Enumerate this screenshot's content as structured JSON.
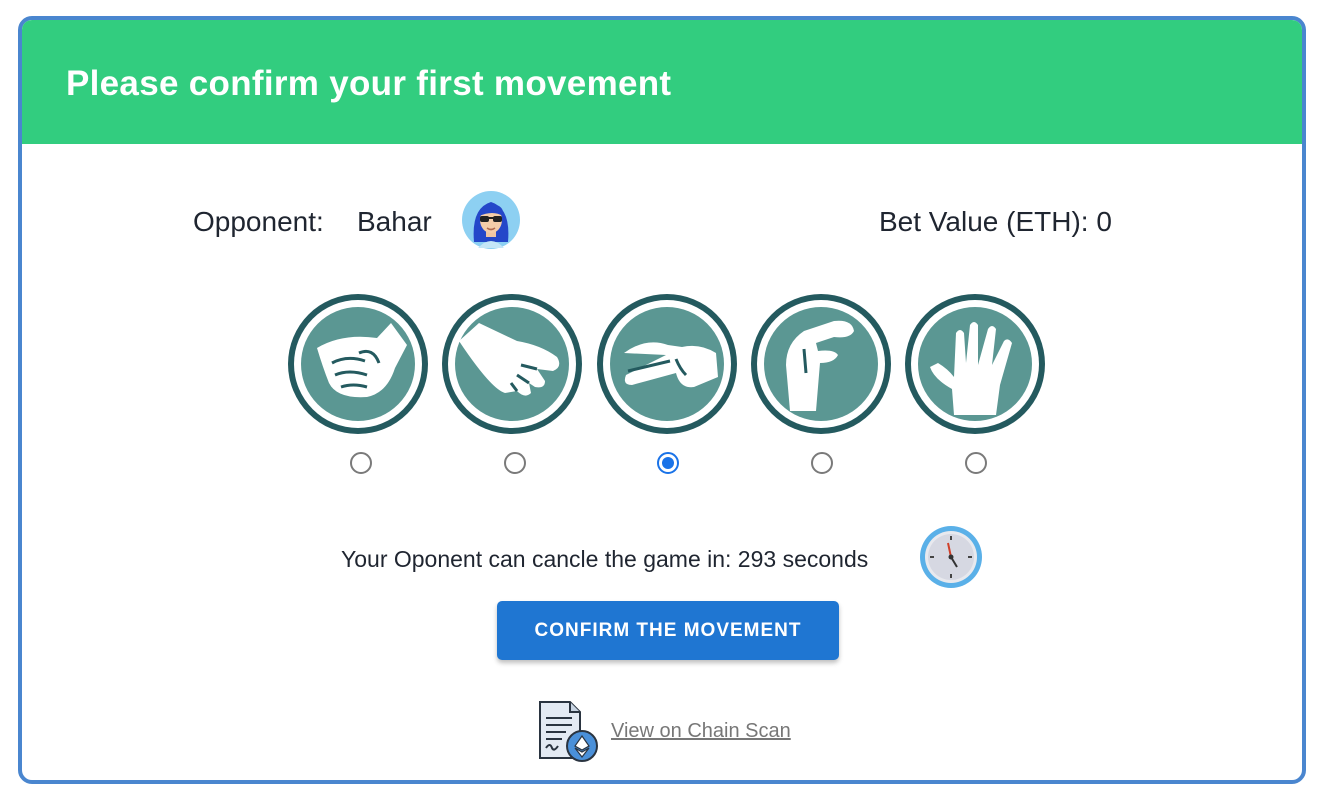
{
  "header": {
    "title": "Please confirm your first movement"
  },
  "opponent": {
    "label": "Opponent:",
    "name": "Bahar"
  },
  "bet": {
    "text": "Bet Value (ETH): 0"
  },
  "moves": [
    {
      "name": "rock",
      "icon": "rock-hand-icon",
      "selected": false
    },
    {
      "name": "paper",
      "icon": "paper-hand-icon",
      "selected": false
    },
    {
      "name": "scissors",
      "icon": "scissors-hand-icon",
      "selected": true
    },
    {
      "name": "lizard",
      "icon": "lizard-hand-icon",
      "selected": false
    },
    {
      "name": "spock",
      "icon": "spock-hand-icon",
      "selected": false
    }
  ],
  "timer": {
    "text": "Your Oponent can cancle the game in: 293 seconds"
  },
  "confirm_button": {
    "label": "CONFIRM THE MOVEMENT"
  },
  "chain_link": {
    "label": "View on Chain Scan"
  },
  "colors": {
    "header": "#32cd7f",
    "border": "#4a86cf",
    "button": "#1f76d2",
    "move_ring": "#245a5f",
    "move_fill": "#5b9793"
  }
}
